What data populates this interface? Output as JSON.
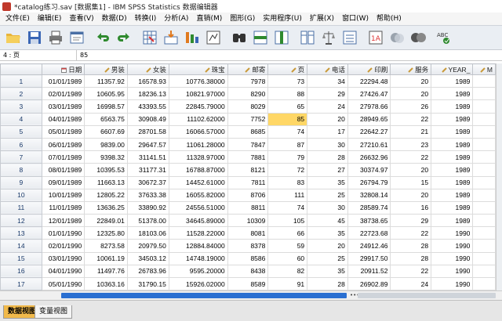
{
  "window": {
    "title": "*catalog练习.sav [数据集1] - IBM SPSS Statistics 数据编辑器"
  },
  "menu": [
    "文件(E)",
    "编辑(E)",
    "查看(V)",
    "数据(D)",
    "转换(I)",
    "分析(A)",
    "直销(M)",
    "图形(G)",
    "实用程序(U)",
    "扩展(X)",
    "窗口(W)",
    "帮助(H)"
  ],
  "toolbar": {
    "icons": [
      "open-folder-icon",
      "save-icon",
      "print-icon",
      "dialog-recall-icon",
      "undo-icon",
      "redo-icon",
      "goto-case-icon",
      "goto-variable-icon",
      "variables-icon",
      "descriptive-stats-icon",
      "find-icon",
      "insert-cases-icon",
      "insert-variable-icon",
      "split-file-icon",
      "weight-cases-icon",
      "select-cases-icon",
      "value-labels-icon",
      "use-sets-icon",
      "show-all-variables-icon",
      "spell-check-icon"
    ]
  },
  "cell_editor": {
    "reference": "4 : 页",
    "value": "85"
  },
  "columns": [
    "日期",
    "男装",
    "女装",
    "珠宝",
    "邮寄",
    "页",
    "电话",
    "印刷",
    "服务",
    "YEAR_",
    "M"
  ],
  "rows": [
    [
      "01/01/1989",
      "11357.92",
      "16578.93",
      "10776.38000",
      "7978",
      "73",
      "34",
      "22294.48",
      "20",
      "1989"
    ],
    [
      "02/01/1989",
      "10605.95",
      "18236.13",
      "10821.97000",
      "8290",
      "88",
      "29",
      "27426.47",
      "20",
      "1989"
    ],
    [
      "03/01/1989",
      "16998.57",
      "43393.55",
      "22845.79000",
      "8029",
      "65",
      "24",
      "27978.66",
      "26",
      "1989"
    ],
    [
      "04/01/1989",
      "6563.75",
      "30908.49",
      "11102.62000",
      "7752",
      "85",
      "20",
      "28949.65",
      "22",
      "1989"
    ],
    [
      "05/01/1989",
      "6607.69",
      "28701.58",
      "16066.57000",
      "8685",
      "74",
      "17",
      "22642.27",
      "21",
      "1989"
    ],
    [
      "06/01/1989",
      "9839.00",
      "29647.57",
      "11061.28000",
      "7847",
      "87",
      "30",
      "27210.61",
      "23",
      "1989"
    ],
    [
      "07/01/1989",
      "9398.32",
      "31141.51",
      "11328.97000",
      "7881",
      "79",
      "28",
      "26632.96",
      "22",
      "1989"
    ],
    [
      "08/01/1989",
      "10395.53",
      "31177.31",
      "16788.87000",
      "8121",
      "72",
      "27",
      "30374.97",
      "20",
      "1989"
    ],
    [
      "09/01/1989",
      "11663.13",
      "30672.37",
      "14452.61000",
      "7811",
      "83",
      "35",
      "26794.79",
      "15",
      "1989"
    ],
    [
      "10/01/1989",
      "12805.22",
      "37633.38",
      "16055.82000",
      "8706",
      "111",
      "25",
      "32808.14",
      "20",
      "1989"
    ],
    [
      "11/01/1989",
      "13636.25",
      "33890.92",
      "24556.51000",
      "8811",
      "74",
      "30",
      "28589.74",
      "16",
      "1989"
    ],
    [
      "12/01/1989",
      "22849.01",
      "51378.00",
      "34645.89000",
      "10309",
      "105",
      "45",
      "38738.65",
      "29",
      "1989"
    ],
    [
      "01/01/1990",
      "12325.80",
      "18103.06",
      "11528.22000",
      "8081",
      "66",
      "35",
      "22723.68",
      "22",
      "1990"
    ],
    [
      "02/01/1990",
      "8273.58",
      "20979.50",
      "12884.84000",
      "8378",
      "59",
      "20",
      "24912.46",
      "28",
      "1990"
    ],
    [
      "03/01/1990",
      "10061.19",
      "34503.12",
      "14748.19000",
      "8586",
      "60",
      "25",
      "29917.50",
      "28",
      "1990"
    ],
    [
      "04/01/1990",
      "11497.76",
      "26783.96",
      "9595.20000",
      "8438",
      "82",
      "35",
      "20911.52",
      "22",
      "1990"
    ],
    [
      "05/01/1990",
      "10363.16",
      "31790.15",
      "15926.02000",
      "8589",
      "91",
      "28",
      "26902.89",
      "24",
      "1990"
    ],
    [
      "06/01/1990",
      "10194.68",
      "32432.74",
      "11383.03000",
      "8565",
      "80",
      "25",
      "26079.17",
      "25",
      "1990"
    ]
  ],
  "selected": {
    "row": 4,
    "col": 6
  },
  "tabs": {
    "data_view": "数据视图",
    "variable_view": "变量视图"
  },
  "colors": {
    "selected_cell": "#ffd766",
    "active_tab": "#f1b94a",
    "scroll_thumb": "#2a6fd1"
  }
}
